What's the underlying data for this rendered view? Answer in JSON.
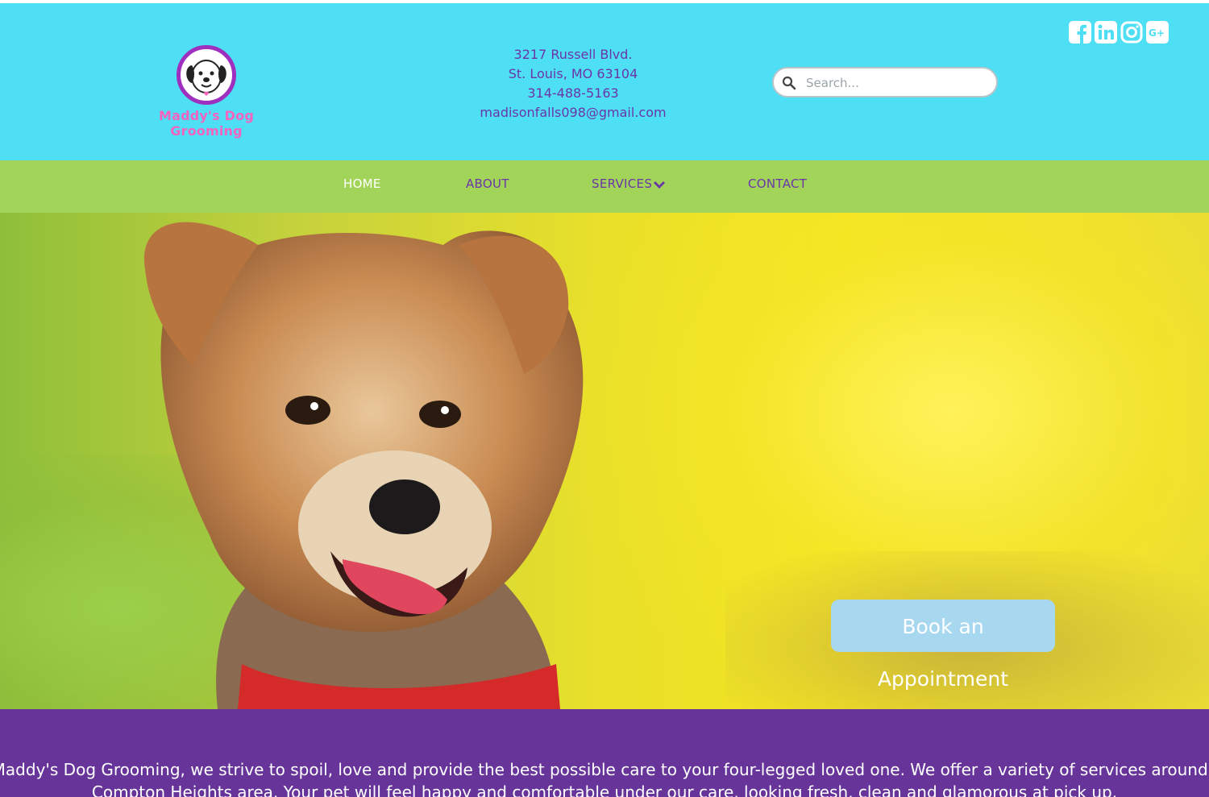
{
  "header": {
    "logo_text": "Maddy's Dog Grooming",
    "address_line1": "3217 Russell Blvd.",
    "address_line2": "St. Louis, MO 63104",
    "phone": "314-488-5163",
    "email": "madisonfalls098@gmail.com",
    "search_placeholder": "Search...",
    "social_icons": [
      "facebook-icon",
      "linkedin-icon",
      "instagram-icon",
      "google-plus-icon"
    ]
  },
  "nav": {
    "items": [
      {
        "label": "HOME"
      },
      {
        "label": "ABOUT"
      },
      {
        "label": "SERVICES"
      },
      {
        "label": "CONTACT"
      }
    ]
  },
  "hero": {
    "button_label": "Book an Appointment"
  },
  "intro": {
    "text": "At Maddy's Dog Grooming, we strive to spoil, love and provide the best possible care to your four-legged loved one. We offer a variety of services around the Compton Heights area. Your pet will feel happy and comfortable under our care, looking fresh, clean and glamorous at pick up."
  },
  "colors": {
    "header_bg": "#4fdff5",
    "nav_bg": "#a2d45a",
    "brand_purple": "#673499",
    "text_purple": "#6b35a8",
    "logo_pink": "#f464bf",
    "button_blue": "#a8d8f0"
  }
}
